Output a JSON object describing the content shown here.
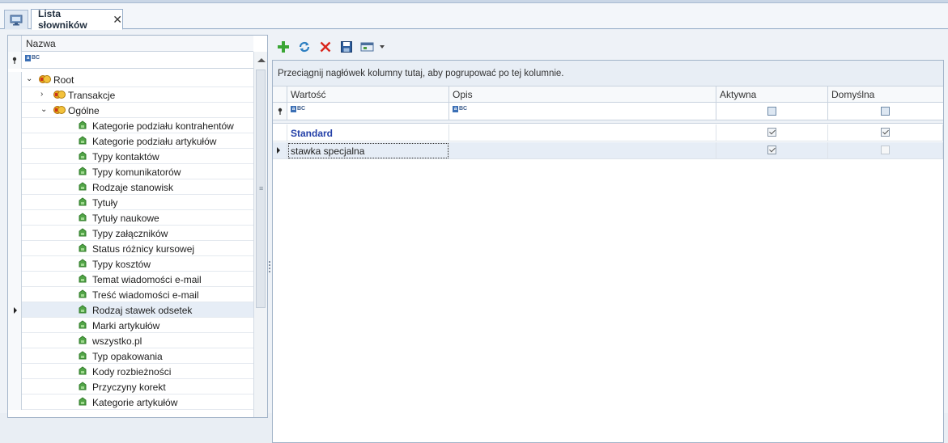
{
  "tabs": {
    "active_title": "Lista słowników",
    "close_glyph": "✕"
  },
  "tree": {
    "column_header": "Nazwa",
    "items": [
      {
        "label": "Root",
        "level": 0,
        "icon": "folder-coins-icon",
        "expander": "⌄"
      },
      {
        "label": "Transakcje",
        "level": 1,
        "icon": "folder-coins-icon",
        "expander": "›"
      },
      {
        "label": "Ogólne",
        "level": 1,
        "icon": "folder-coins-icon",
        "expander": "⌄"
      },
      {
        "label": "Kategorie podziału kontrahentów",
        "level": 2,
        "icon": "dictionary-leaf-icon"
      },
      {
        "label": "Kategorie podziału artykułów",
        "level": 2,
        "icon": "dictionary-leaf-icon"
      },
      {
        "label": "Typy kontaktów",
        "level": 2,
        "icon": "dictionary-leaf-icon"
      },
      {
        "label": "Typy komunikatorów",
        "level": 2,
        "icon": "dictionary-leaf-icon"
      },
      {
        "label": "Rodzaje stanowisk",
        "level": 2,
        "icon": "dictionary-leaf-icon"
      },
      {
        "label": "Tytuły",
        "level": 2,
        "icon": "dictionary-leaf-icon"
      },
      {
        "label": "Tytuły naukowe",
        "level": 2,
        "icon": "dictionary-leaf-icon"
      },
      {
        "label": "Typy załączników",
        "level": 2,
        "icon": "dictionary-leaf-icon"
      },
      {
        "label": "Status różnicy kursowej",
        "level": 2,
        "icon": "dictionary-leaf-icon"
      },
      {
        "label": "Typy kosztów",
        "level": 2,
        "icon": "dictionary-leaf-icon"
      },
      {
        "label": "Temat wiadomości e-mail",
        "level": 2,
        "icon": "dictionary-leaf-icon"
      },
      {
        "label": "Treść wiadomości e-mail",
        "level": 2,
        "icon": "dictionary-leaf-icon"
      },
      {
        "label": "Rodzaj stawek odsetek",
        "level": 2,
        "icon": "dictionary-leaf-icon",
        "selected": true
      },
      {
        "label": "Marki artykułów",
        "level": 2,
        "icon": "dictionary-leaf-icon"
      },
      {
        "label": "wszystko.pl",
        "level": 2,
        "icon": "dictionary-leaf-icon"
      },
      {
        "label": "Typ opakowania",
        "level": 2,
        "icon": "dictionary-leaf-icon"
      },
      {
        "label": "Kody rozbieżności",
        "level": 2,
        "icon": "dictionary-leaf-icon"
      },
      {
        "label": "Przyczyny korekt",
        "level": 2,
        "icon": "dictionary-leaf-icon"
      },
      {
        "label": "Kategorie artykułów",
        "level": 2,
        "icon": "dictionary-leaf-icon"
      }
    ]
  },
  "toolbar": {
    "buttons": [
      "add-icon",
      "refresh-icon",
      "delete-icon",
      "save-icon",
      "view-options-icon"
    ]
  },
  "grid": {
    "group_hint": "Przeciągnij nagłówek kolumny tutaj, aby pogrupować po tej kolumnie.",
    "columns": [
      "Wartość",
      "Opis",
      "Aktywna",
      "Domyślna"
    ],
    "rows": [
      {
        "wartosc": "Standard",
        "opis": "",
        "aktywna": true,
        "domyslna": true
      },
      {
        "wartosc": "stawka specjalna",
        "opis": "",
        "aktywna": true,
        "domyslna": false
      }
    ]
  },
  "colors": {
    "accent": "#2440a8",
    "add": "#3aa635",
    "delete": "#d9261c",
    "refresh": "#2d7fc1"
  }
}
